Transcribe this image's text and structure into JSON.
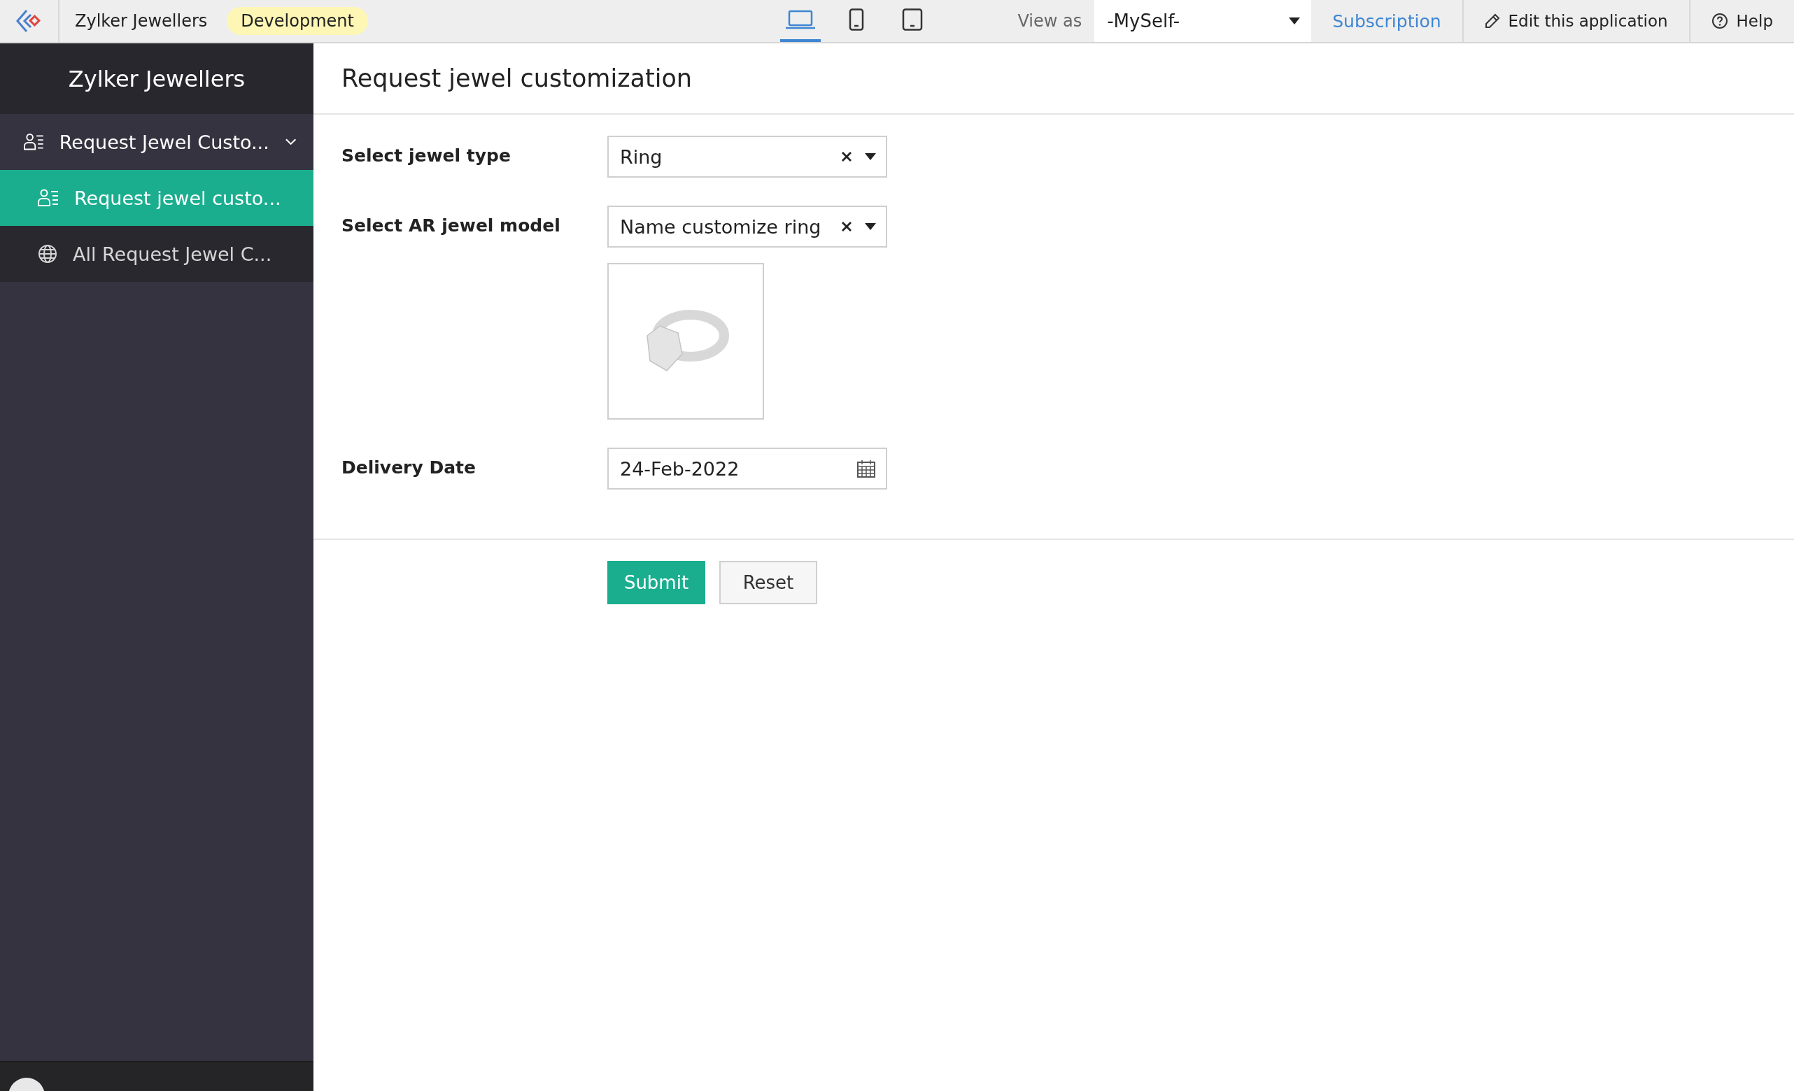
{
  "app_bar": {
    "app_name": "Zylker Jewellers",
    "environment": "Development",
    "devices": [
      {
        "kind": "laptop",
        "selected": true
      },
      {
        "kind": "phone",
        "selected": false
      },
      {
        "kind": "tablet",
        "selected": false
      }
    ],
    "view_as": {
      "label": "View as",
      "value": "-MySelf-"
    },
    "subscription": "Subscription",
    "edit": "Edit this application",
    "help": "Help"
  },
  "sidebar": {
    "title": "Zylker Jewellers",
    "items": [
      {
        "label": "Request Jewel Custo...",
        "kind": "form",
        "expanded": true,
        "selected": false,
        "children": [
          {
            "label": "Request jewel custo...",
            "kind": "form",
            "selected": true
          },
          {
            "label": "All Request Jewel C...",
            "kind": "report",
            "selected": false
          }
        ]
      }
    ]
  },
  "form": {
    "title": "Request jewel customization",
    "fields": [
      {
        "label": "Select jewel type",
        "kind": "select",
        "value": "Ring"
      },
      {
        "label": "Select AR jewel model",
        "kind": "model_select",
        "value": "Name customize ring"
      },
      {
        "label": "Delivery Date",
        "kind": "date",
        "value": "24-Feb-2022"
      }
    ],
    "buttons": [
      {
        "label": "Submit",
        "kind": "primary"
      },
      {
        "label": "Reset",
        "kind": "secondary"
      }
    ]
  }
}
